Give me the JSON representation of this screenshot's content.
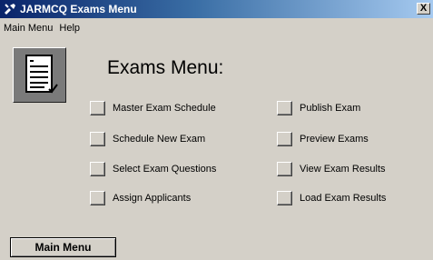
{
  "window": {
    "title": "JARMCQ Exams Menu",
    "close_label": "X"
  },
  "menubar": {
    "items": [
      "Main Menu",
      "Help"
    ]
  },
  "main": {
    "heading": "Exams Menu:",
    "left_options": [
      "Master Exam Schedule",
      "Schedule New Exam",
      "Select Exam Questions",
      "Assign Applicants"
    ],
    "right_options": [
      "Publish Exam",
      "Preview Exams",
      "View Exam Results",
      "Load Exam Results"
    ]
  },
  "footer": {
    "main_menu_label": "Main Menu"
  },
  "icons": {
    "title": "tool-icon",
    "logo": "checklist-document-icon"
  },
  "colors": {
    "title_gradient_start": "#0a246a",
    "title_gradient_end": "#a6caf0",
    "face": "#d4d0c8"
  }
}
